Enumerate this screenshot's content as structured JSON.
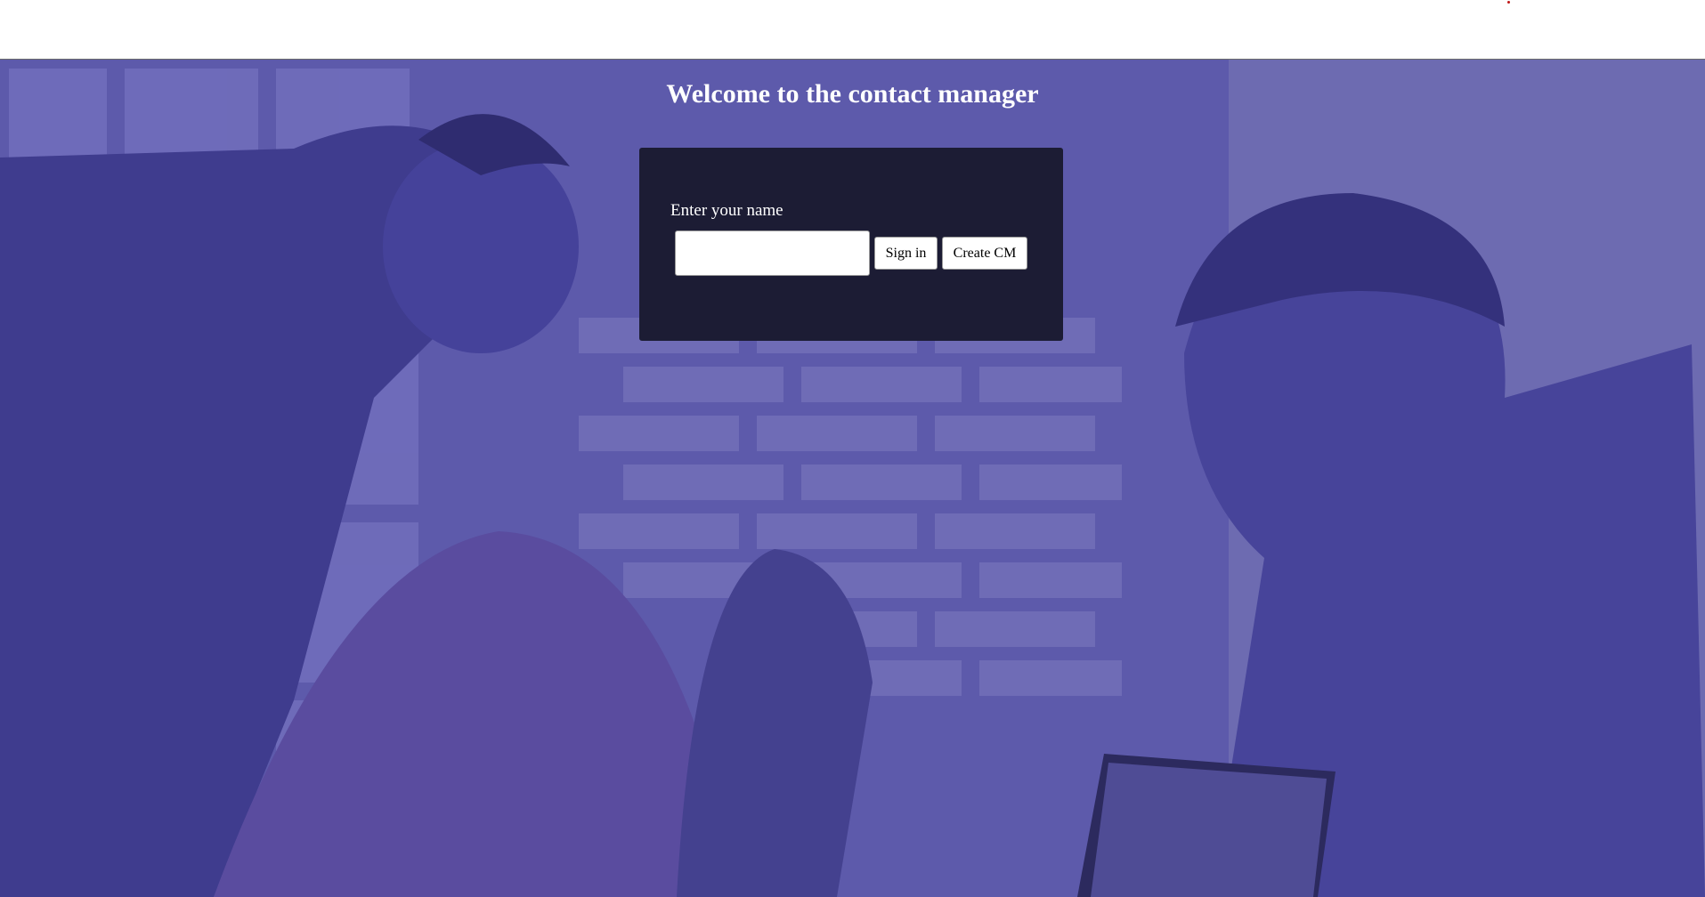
{
  "header": {
    "title": "Welcome to the contact manager"
  },
  "login": {
    "label": "Enter your name",
    "name_value": "",
    "name_placeholder": "",
    "signin_label": "Sign in",
    "create_label": "Create CM"
  },
  "colors": {
    "overlay": "#5b58a8",
    "card_bg": "#1c1c34",
    "text": "#ffffff"
  }
}
